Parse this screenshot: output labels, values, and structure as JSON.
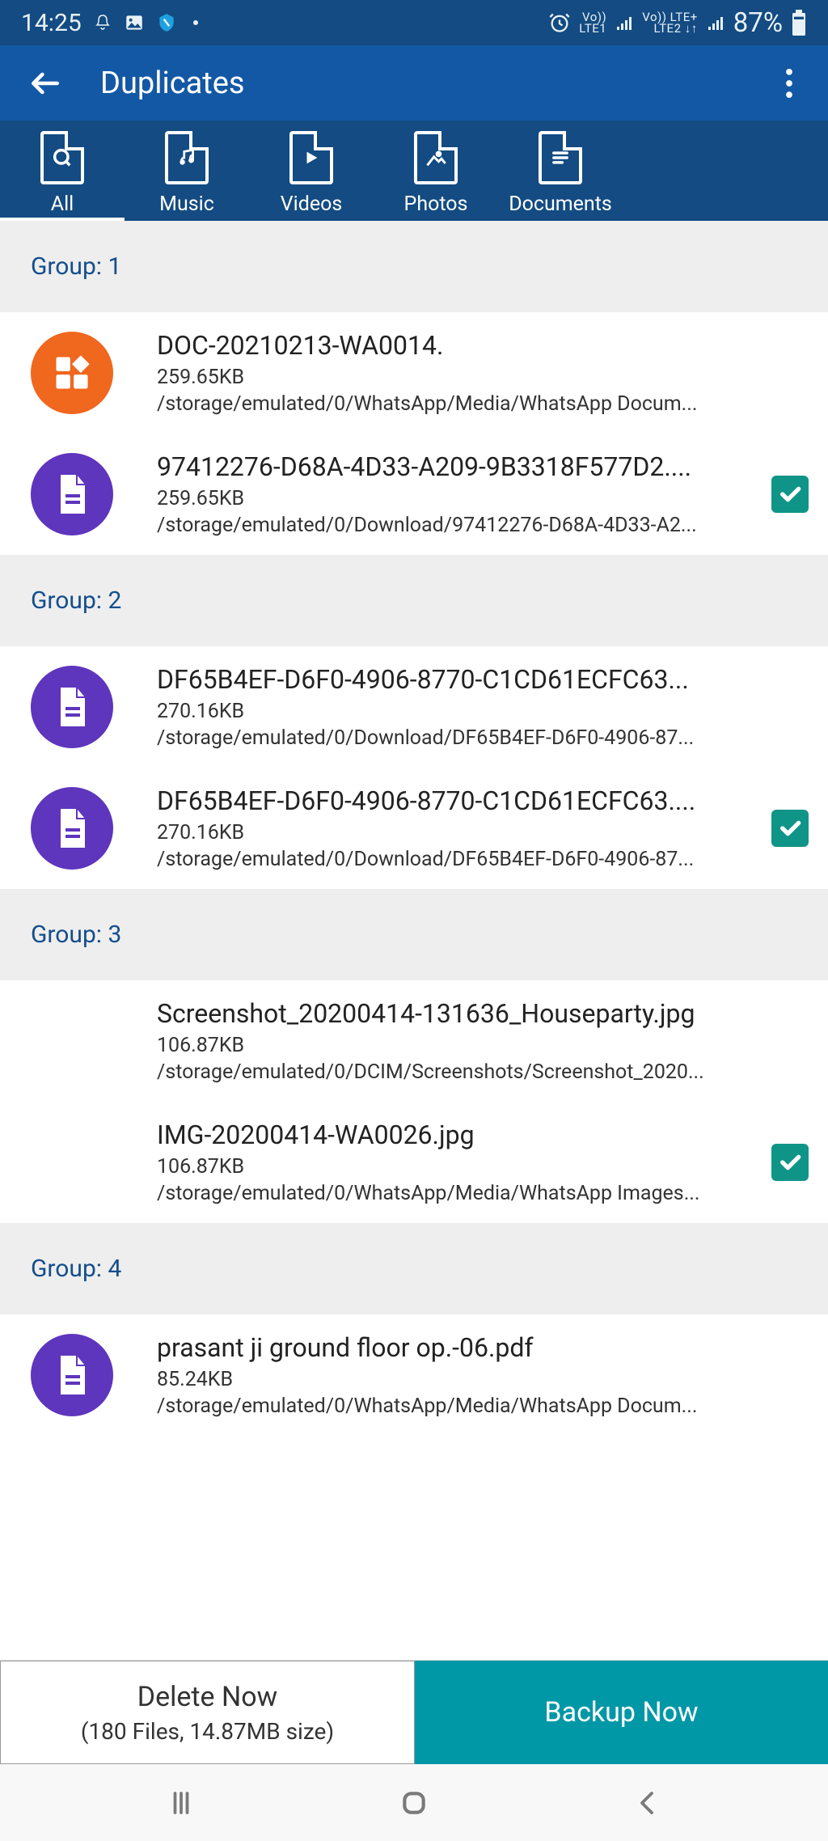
{
  "status": {
    "time": "14:25",
    "battery": "87%",
    "sim1": "Vo))\nLTE1",
    "sim2": "Vo)) LTE+\nLTE2"
  },
  "header": {
    "title": "Duplicates"
  },
  "tabs": [
    {
      "label": "All"
    },
    {
      "label": "Music"
    },
    {
      "label": "Videos"
    },
    {
      "label": "Photos"
    },
    {
      "label": "Documents"
    }
  ],
  "groups": [
    {
      "title": "Group: 1",
      "items": [
        {
          "name": "DOC-20210213-WA0014.",
          "size": "259.65KB",
          "path": "/storage/emulated/0/WhatsApp/Media/WhatsApp Docum...",
          "icon": "orange-apk",
          "checked": false
        },
        {
          "name": "97412276-D68A-4D33-A209-9B3318F577D2....",
          "size": "259.65KB",
          "path": "/storage/emulated/0/Download/97412276-D68A-4D33-A2...",
          "icon": "purple-doc",
          "checked": true
        }
      ]
    },
    {
      "title": "Group: 2",
      "items": [
        {
          "name": "DF65B4EF-D6F0-4906-8770-C1CD61ECFC63...",
          "size": "270.16KB",
          "path": "/storage/emulated/0/Download/DF65B4EF-D6F0-4906-87...",
          "icon": "purple-doc",
          "checked": false
        },
        {
          "name": "DF65B4EF-D6F0-4906-8770-C1CD61ECFC63....",
          "size": "270.16KB",
          "path": "/storage/emulated/0/Download/DF65B4EF-D6F0-4906-87...",
          "icon": "purple-doc",
          "checked": true
        }
      ]
    },
    {
      "title": "Group: 3",
      "items": [
        {
          "name": "Screenshot_20200414-131636_Houseparty.jpg",
          "size": "106.87KB",
          "path": "/storage/emulated/0/DCIM/Screenshots/Screenshot_2020...",
          "icon": "blank",
          "checked": false
        },
        {
          "name": "IMG-20200414-WA0026.jpg",
          "size": "106.87KB",
          "path": "/storage/emulated/0/WhatsApp/Media/WhatsApp Images...",
          "icon": "blank",
          "checked": true
        }
      ]
    },
    {
      "title": "Group: 4",
      "items": [
        {
          "name": "prasant ji ground floor op.-06.pdf",
          "size": "85.24KB",
          "path": "/storage/emulated/0/WhatsApp/Media/WhatsApp Docum...",
          "icon": "purple-doc",
          "checked": false
        }
      ]
    }
  ],
  "footer": {
    "delete_label": "Delete Now",
    "delete_sub": "(180 Files, 14.87MB size)",
    "backup_label": "Backup Now"
  }
}
